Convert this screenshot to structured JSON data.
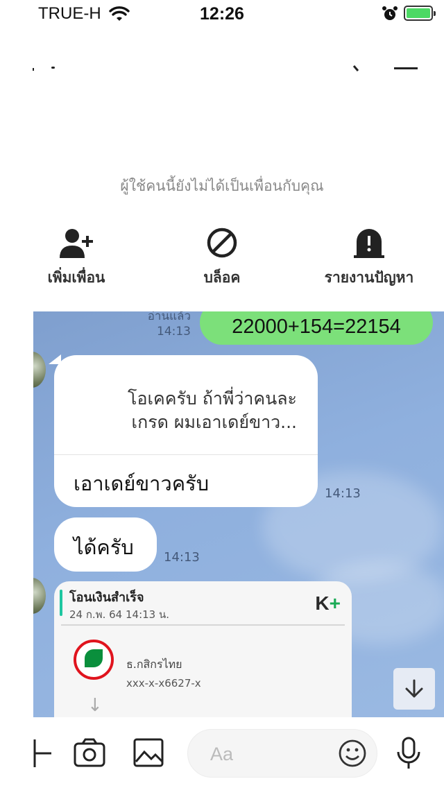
{
  "status_bar": {
    "carrier": "TRUE-H",
    "time": "12:26"
  },
  "banner": {
    "not_friend_text": "ผู้ใช้คนนี้ยังไม่ได้เป็นเพื่อนกับคุณ",
    "actions": [
      {
        "label": "เพิ่มเพื่อน",
        "icon": "add-friend-icon"
      },
      {
        "label": "บล็อค",
        "icon": "block-icon"
      },
      {
        "label": "รายงานปัญหา",
        "icon": "report-icon"
      }
    ]
  },
  "messages": {
    "sent_partial": {
      "text": "22000+154=22154",
      "read_label": "อ่านแล้ว",
      "time": "14:13"
    },
    "reply": {
      "quoted_line1": "โอเคครับ ถ้าพี่ว่าคนละ",
      "quoted_line2": "เกรด ผมเอาเดย์ขาว...",
      "text": "เอาเดย์ขาวครับ",
      "time": "14:13"
    },
    "short": {
      "text": "ได้ครับ",
      "time": "14:13"
    },
    "transfer_card": {
      "title": "โอนเงินสำเร็จ",
      "subtitle": "24 ก.พ. 64  14:13 น.",
      "logo_k": "K",
      "logo_plus": "+",
      "bank_name": "ธ.กสิกรไทย",
      "account": "xxx-x-x6627-x"
    }
  },
  "input": {
    "placeholder": "Aa"
  },
  "colors": {
    "sent_bubble": "#7ce07a",
    "chat_background": "#8fb0de",
    "bank_red": "#e0141e",
    "bank_green": "#0a8f3c",
    "kplus_green": "#1aaa55"
  }
}
